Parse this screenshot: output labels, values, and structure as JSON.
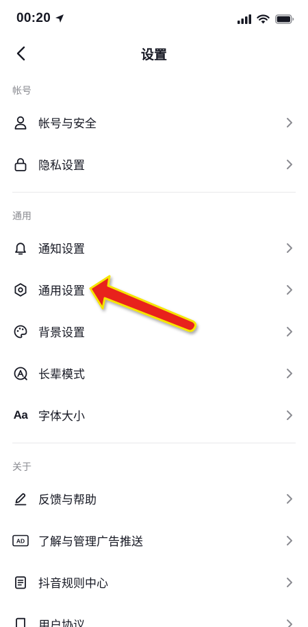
{
  "status_bar": {
    "time": "00:20"
  },
  "nav": {
    "title": "设置"
  },
  "sections": [
    {
      "header": "帐号",
      "items": [
        {
          "label": "帐号与安全",
          "icon": "user-icon"
        },
        {
          "label": "隐私设置",
          "icon": "lock-icon"
        }
      ]
    },
    {
      "header": "通用",
      "items": [
        {
          "label": "通知设置",
          "icon": "bell-icon"
        },
        {
          "label": "通用设置",
          "icon": "gear-icon"
        },
        {
          "label": "背景设置",
          "icon": "palette-icon"
        },
        {
          "label": "长辈模式",
          "icon": "elder-mode-icon"
        },
        {
          "label": "字体大小",
          "icon": "font-size-icon",
          "icon_text": "Aa"
        }
      ]
    },
    {
      "header": "关于",
      "items": [
        {
          "label": "反馈与帮助",
          "icon": "edit-icon"
        },
        {
          "label": "了解与管理广告推送",
          "icon": "ad-icon",
          "icon_text": "AD"
        },
        {
          "label": "抖音规则中心",
          "icon": "document-icon"
        },
        {
          "label": "用户协议",
          "icon": "book-icon"
        }
      ]
    }
  ],
  "colors": {
    "text": "#161823",
    "secondary": "#8a8b91",
    "divider": "#e8e8ea",
    "annotation_arrow": "#e8201c",
    "annotation_outline": "#f5e400"
  }
}
